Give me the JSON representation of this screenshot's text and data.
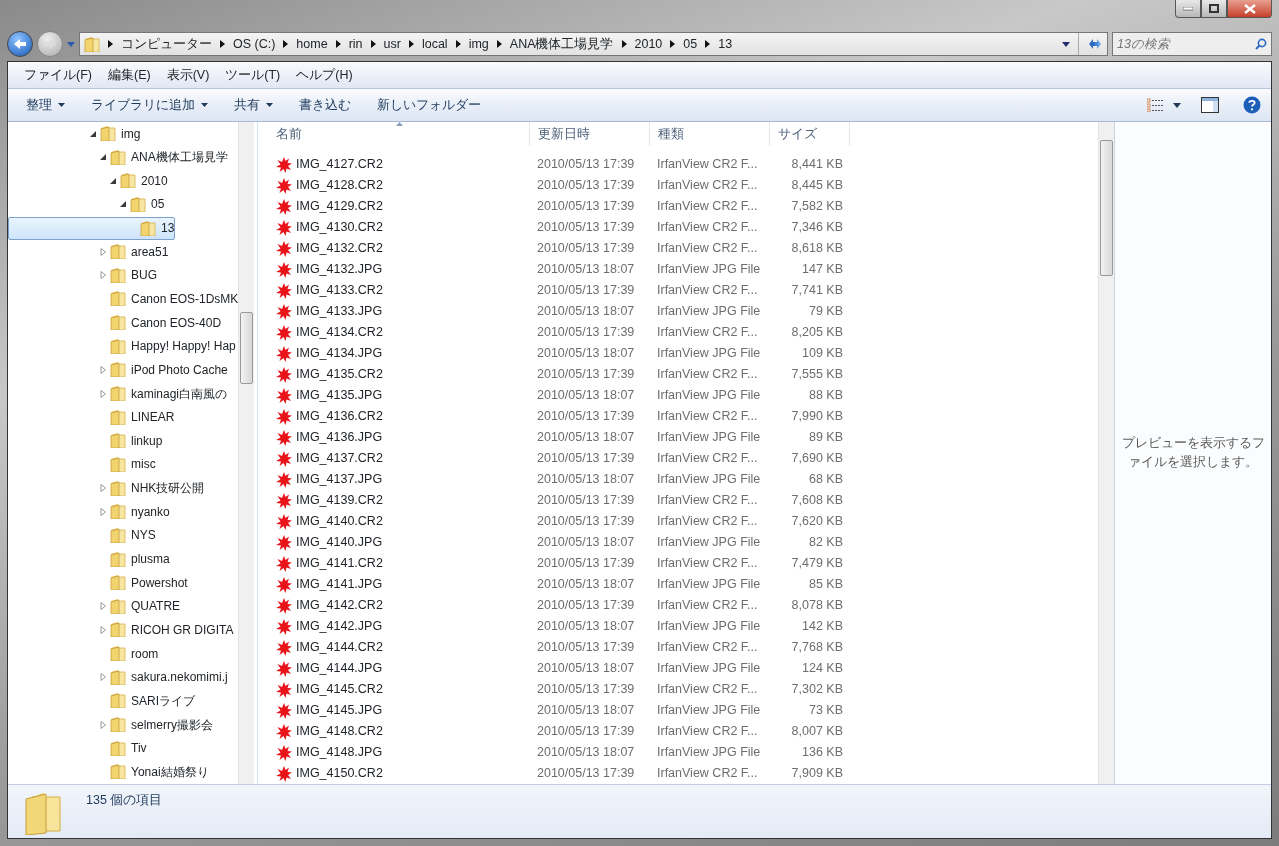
{
  "address_bar": {
    "crumbs": [
      "コンピューター",
      "OS (C:)",
      "home",
      "rin",
      "usr",
      "local",
      "img",
      "ANA機体工場見学",
      "2010",
      "05",
      "13"
    ]
  },
  "search": {
    "placeholder": "13の検索"
  },
  "menu": [
    "ファイル(F)",
    "編集(E)",
    "表示(V)",
    "ツール(T)",
    "ヘルプ(H)"
  ],
  "toolbar": [
    {
      "label": "整理",
      "dropdown": true
    },
    {
      "label": "ライブラリに追加",
      "dropdown": true
    },
    {
      "label": "共有",
      "dropdown": true
    },
    {
      "label": "書き込む",
      "dropdown": false
    },
    {
      "label": "新しいフォルダー",
      "dropdown": false
    }
  ],
  "nav_tree": [
    {
      "label": "img",
      "kind": "branch",
      "expanded": true,
      "selected": false,
      "children": [
        {
          "label": "ANA機体工場見学",
          "kind": "branch",
          "expanded": true,
          "selected": false,
          "children": [
            {
              "label": "2010",
              "kind": "branch",
              "expanded": true,
              "selected": false,
              "children": [
                {
                  "label": "05",
                  "kind": "branch",
                  "expanded": true,
                  "selected": false,
                  "children": [
                    {
                      "label": "13",
                      "kind": "leaf",
                      "selected": true
                    }
                  ]
                }
              ]
            }
          ]
        },
        {
          "label": "area51",
          "kind": "branch",
          "expanded": false,
          "selected": false
        },
        {
          "label": "BUG",
          "kind": "branch",
          "expanded": false,
          "selected": false
        },
        {
          "label": "Canon EOS-1DsMK",
          "kind": "leaf",
          "selected": false
        },
        {
          "label": "Canon EOS-40D",
          "kind": "leaf",
          "selected": false
        },
        {
          "label": "Happy! Happy! Hap",
          "kind": "leaf",
          "selected": false
        },
        {
          "label": "iPod Photo Cache",
          "kind": "branch",
          "expanded": false,
          "selected": false
        },
        {
          "label": "kaminagi白南風の",
          "kind": "branch",
          "expanded": false,
          "selected": false
        },
        {
          "label": "LINEAR",
          "kind": "leaf",
          "selected": false
        },
        {
          "label": "linkup",
          "kind": "leaf",
          "selected": false
        },
        {
          "label": "misc",
          "kind": "leaf",
          "selected": false
        },
        {
          "label": "NHK技研公開",
          "kind": "branch",
          "expanded": false,
          "selected": false
        },
        {
          "label": "nyanko",
          "kind": "branch",
          "expanded": false,
          "selected": false
        },
        {
          "label": "NYS",
          "kind": "leaf",
          "selected": false
        },
        {
          "label": "plusma",
          "kind": "leaf",
          "selected": false
        },
        {
          "label": "Powershot",
          "kind": "leaf",
          "selected": false
        },
        {
          "label": "QUATRE",
          "kind": "branch",
          "expanded": false,
          "selected": false
        },
        {
          "label": "RICOH GR DIGITA",
          "kind": "branch",
          "expanded": false,
          "selected": false
        },
        {
          "label": "room",
          "kind": "leaf",
          "selected": false
        },
        {
          "label": "sakura.nekomimi.j",
          "kind": "branch",
          "expanded": false,
          "selected": false
        },
        {
          "label": "SARIライブ",
          "kind": "leaf",
          "selected": false
        },
        {
          "label": "selmerry撮影会",
          "kind": "branch",
          "expanded": false,
          "selected": false
        },
        {
          "label": "Tiv",
          "kind": "leaf",
          "selected": false
        },
        {
          "label": "Yonai結婚祭り",
          "kind": "leaf",
          "selected": false
        }
      ]
    }
  ],
  "file_list": {
    "columns": [
      {
        "label": "名前",
        "sorted": true
      },
      {
        "label": "更新日時",
        "sorted": false
      },
      {
        "label": "種類",
        "sorted": false
      },
      {
        "label": "サイズ",
        "sorted": false
      }
    ],
    "rows": [
      {
        "name": "IMG_4127.CR2",
        "modified": "2010/05/13 17:39",
        "type": "IrfanView CR2 F...",
        "size": "8,441 KB"
      },
      {
        "name": "IMG_4128.CR2",
        "modified": "2010/05/13 17:39",
        "type": "IrfanView CR2 F...",
        "size": "8,445 KB"
      },
      {
        "name": "IMG_4129.CR2",
        "modified": "2010/05/13 17:39",
        "type": "IrfanView CR2 F...",
        "size": "7,582 KB"
      },
      {
        "name": "IMG_4130.CR2",
        "modified": "2010/05/13 17:39",
        "type": "IrfanView CR2 F...",
        "size": "7,346 KB"
      },
      {
        "name": "IMG_4132.CR2",
        "modified": "2010/05/13 17:39",
        "type": "IrfanView CR2 F...",
        "size": "8,618 KB"
      },
      {
        "name": "IMG_4132.JPG",
        "modified": "2010/05/13 18:07",
        "type": "IrfanView JPG File",
        "size": "147 KB"
      },
      {
        "name": "IMG_4133.CR2",
        "modified": "2010/05/13 17:39",
        "type": "IrfanView CR2 F...",
        "size": "7,741 KB"
      },
      {
        "name": "IMG_4133.JPG",
        "modified": "2010/05/13 18:07",
        "type": "IrfanView JPG File",
        "size": "79 KB"
      },
      {
        "name": "IMG_4134.CR2",
        "modified": "2010/05/13 17:39",
        "type": "IrfanView CR2 F...",
        "size": "8,205 KB"
      },
      {
        "name": "IMG_4134.JPG",
        "modified": "2010/05/13 18:07",
        "type": "IrfanView JPG File",
        "size": "109 KB"
      },
      {
        "name": "IMG_4135.CR2",
        "modified": "2010/05/13 17:39",
        "type": "IrfanView CR2 F...",
        "size": "7,555 KB"
      },
      {
        "name": "IMG_4135.JPG",
        "modified": "2010/05/13 18:07",
        "type": "IrfanView JPG File",
        "size": "88 KB"
      },
      {
        "name": "IMG_4136.CR2",
        "modified": "2010/05/13 17:39",
        "type": "IrfanView CR2 F...",
        "size": "7,990 KB"
      },
      {
        "name": "IMG_4136.JPG",
        "modified": "2010/05/13 18:07",
        "type": "IrfanView JPG File",
        "size": "89 KB"
      },
      {
        "name": "IMG_4137.CR2",
        "modified": "2010/05/13 17:39",
        "type": "IrfanView CR2 F...",
        "size": "7,690 KB"
      },
      {
        "name": "IMG_4137.JPG",
        "modified": "2010/05/13 18:07",
        "type": "IrfanView JPG File",
        "size": "68 KB"
      },
      {
        "name": "IMG_4139.CR2",
        "modified": "2010/05/13 17:39",
        "type": "IrfanView CR2 F...",
        "size": "7,608 KB"
      },
      {
        "name": "IMG_4140.CR2",
        "modified": "2010/05/13 17:39",
        "type": "IrfanView CR2 F...",
        "size": "7,620 KB"
      },
      {
        "name": "IMG_4140.JPG",
        "modified": "2010/05/13 18:07",
        "type": "IrfanView JPG File",
        "size": "82 KB"
      },
      {
        "name": "IMG_4141.CR2",
        "modified": "2010/05/13 17:39",
        "type": "IrfanView CR2 F...",
        "size": "7,479 KB"
      },
      {
        "name": "IMG_4141.JPG",
        "modified": "2010/05/13 18:07",
        "type": "IrfanView JPG File",
        "size": "85 KB"
      },
      {
        "name": "IMG_4142.CR2",
        "modified": "2010/05/13 17:39",
        "type": "IrfanView CR2 F...",
        "size": "8,078 KB"
      },
      {
        "name": "IMG_4142.JPG",
        "modified": "2010/05/13 18:07",
        "type": "IrfanView JPG File",
        "size": "142 KB"
      },
      {
        "name": "IMG_4144.CR2",
        "modified": "2010/05/13 17:39",
        "type": "IrfanView CR2 F...",
        "size": "7,768 KB"
      },
      {
        "name": "IMG_4144.JPG",
        "modified": "2010/05/13 18:07",
        "type": "IrfanView JPG File",
        "size": "124 KB"
      },
      {
        "name": "IMG_4145.CR2",
        "modified": "2010/05/13 17:39",
        "type": "IrfanView CR2 F...",
        "size": "7,302 KB"
      },
      {
        "name": "IMG_4145.JPG",
        "modified": "2010/05/13 18:07",
        "type": "IrfanView JPG File",
        "size": "73 KB"
      },
      {
        "name": "IMG_4148.CR2",
        "modified": "2010/05/13 17:39",
        "type": "IrfanView CR2 F...",
        "size": "8,007 KB"
      },
      {
        "name": "IMG_4148.JPG",
        "modified": "2010/05/13 18:07",
        "type": "IrfanView JPG File",
        "size": "136 KB"
      },
      {
        "name": "IMG_4150.CR2",
        "modified": "2010/05/13 17:39",
        "type": "IrfanView CR2 F...",
        "size": "7,909 KB"
      }
    ]
  },
  "preview_pane": {
    "message": "プレビューを表示するファイルを選択します。"
  },
  "status_bar": {
    "count": "135 個の項目"
  }
}
